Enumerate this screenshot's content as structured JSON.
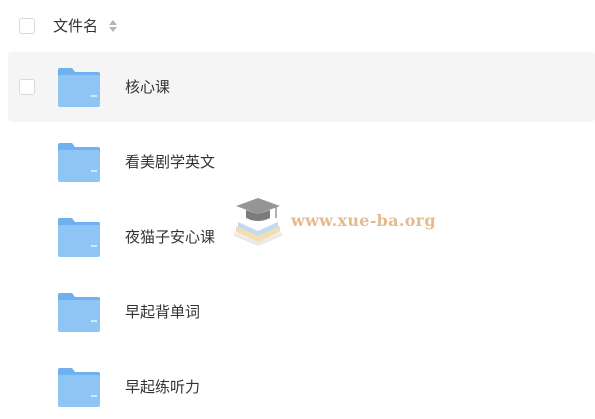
{
  "header": {
    "title": "文件名",
    "sort_icon": "sort-icon"
  },
  "rows": [
    {
      "name": "核心课",
      "icon": "folder-icon",
      "selected": true
    },
    {
      "name": "看美剧学英文",
      "icon": "folder-icon",
      "selected": false
    },
    {
      "name": "夜猫子安心课",
      "icon": "folder-icon",
      "selected": false
    },
    {
      "name": "早起背单词",
      "icon": "folder-icon",
      "selected": false
    },
    {
      "name": "早起练听力",
      "icon": "folder-icon",
      "selected": false
    }
  ],
  "watermark": {
    "text": "www.xue-ba.org"
  },
  "colors": {
    "folder_blue": "#8ec5f5",
    "folder_tab": "#6fb0ee",
    "row_hover": "#f5f5f6",
    "watermark": "#e0b07c"
  }
}
